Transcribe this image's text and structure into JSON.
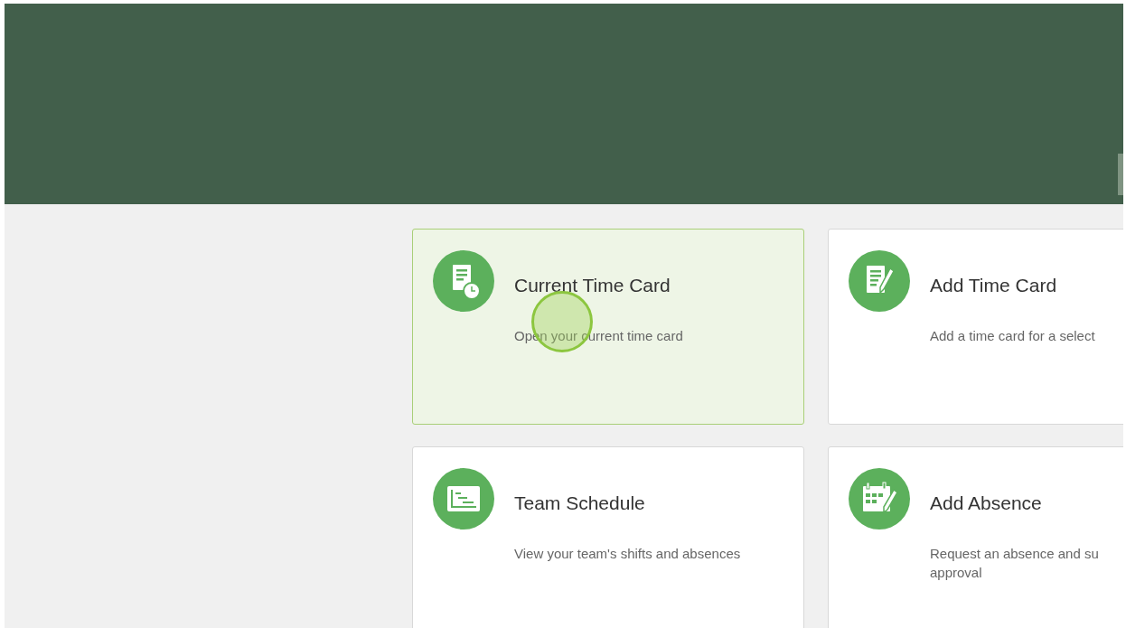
{
  "cards": [
    {
      "title": "Current Time Card",
      "description": [
        "Open your current time card"
      ],
      "selected": true,
      "clicked": true
    },
    {
      "title": "Add Time Card",
      "description": [
        "Add a time card for a select"
      ],
      "selected": false,
      "clicked": false
    },
    {
      "title": "Team Schedule",
      "description": [
        "View your team's shifts and absences"
      ],
      "selected": false,
      "clicked": false
    },
    {
      "title": "Add Absence",
      "description": [
        "Request an absence and su",
        "approval"
      ],
      "selected": false,
      "clicked": false
    }
  ]
}
